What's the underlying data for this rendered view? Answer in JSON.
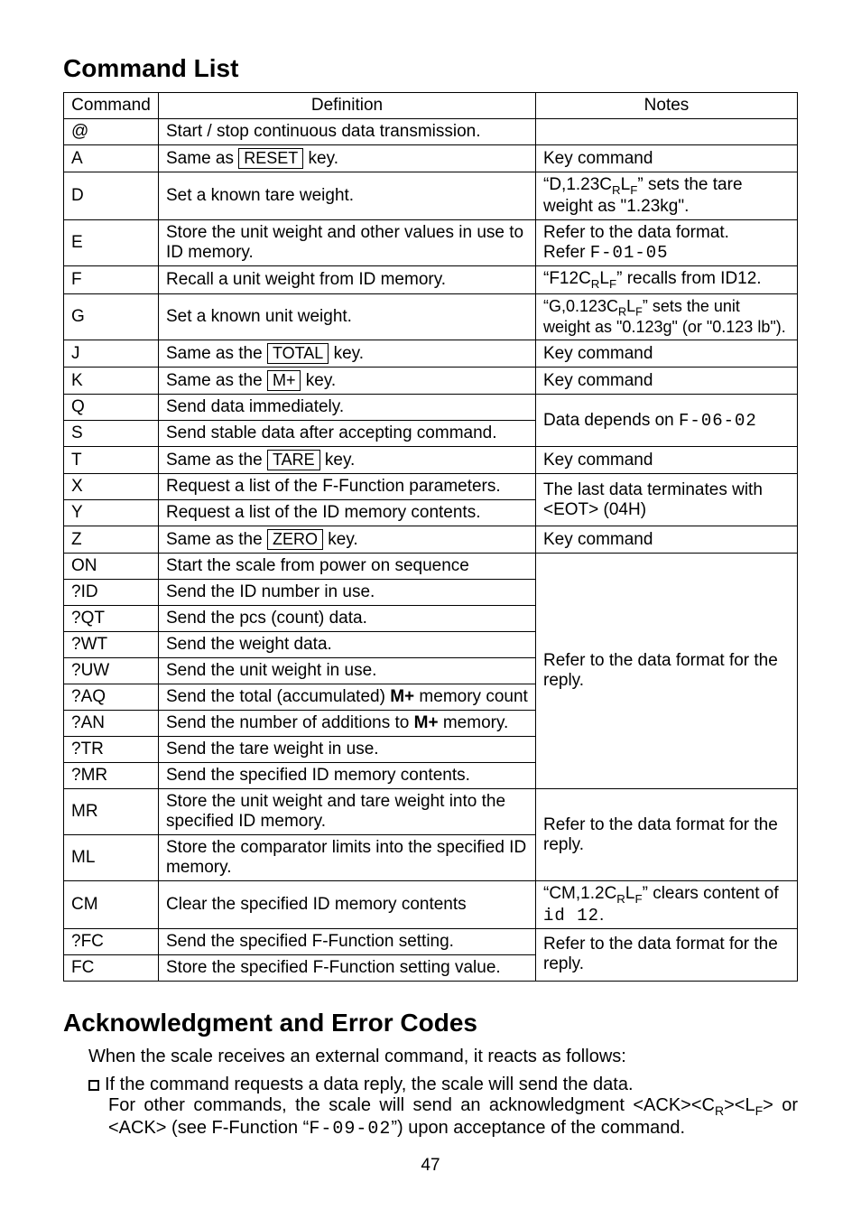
{
  "headings": {
    "command_list": "Command List",
    "ack": "Acknowledgment and Error Codes"
  },
  "table_headers": {
    "command": "Command",
    "definition": "Definition",
    "notes": "Notes"
  },
  "rows": {
    "at": {
      "cmd": "@",
      "def_pre": "Start / stop continuous data transmission.",
      "notes": ""
    },
    "A": {
      "cmd": "A",
      "def_pre": "Same as ",
      "key": "RESET",
      "def_post": " key.",
      "notes": "Key command"
    },
    "D": {
      "cmd": "D",
      "def": "Set a known tare weight.",
      "notes_html": "“D,1.23C<sub>R</sub>L<sub>F</sub>” sets the tare weight as \"1.23kg\"."
    },
    "E": {
      "cmd": "E",
      "def": "Store the unit weight and other values in use to ID memory.",
      "notes_l1": "Refer to the data format.",
      "notes_l2_pre": "Refer ",
      "notes_l2_seg": "F-01-05"
    },
    "F": {
      "cmd": "F",
      "def": "Recall a unit weight from ID memory.",
      "notes_html": "“F12C<sub>R</sub>L<sub>F</sub>” recalls from ID12."
    },
    "G": {
      "cmd": "G",
      "def": "Set a known unit weight.",
      "notes_html": "“G,0.123C<sub>R</sub>L<sub>F</sub>” sets the unit weight as \"0.123g\" (or \"0.123 lb\")."
    },
    "J": {
      "cmd": "J",
      "def_pre": "Same as the ",
      "key": "TOTAL",
      "def_post": " key.",
      "notes": "Key command"
    },
    "K": {
      "cmd": "K",
      "def_pre": "Same as the ",
      "key": "M+",
      "def_post": " key.",
      "notes": "Key command"
    },
    "Q": {
      "cmd": "Q",
      "def": "Send data immediately."
    },
    "S": {
      "cmd": "S",
      "def": "Send stable data after accepting command."
    },
    "QS_notes_pre": "Data depends on ",
    "QS_notes_seg": "F-06-02",
    "T": {
      "cmd": "T",
      "def_pre": "Same as the ",
      "key": "TARE",
      "def_post": " key.",
      "notes": "Key command"
    },
    "X": {
      "cmd": "X",
      "def": "Request a list of the F-Function parameters."
    },
    "Y": {
      "cmd": "Y",
      "def": "Request a list of the ID memory contents."
    },
    "XY_notes": "The last data terminates with <EOT> (04H)",
    "Z": {
      "cmd": "Z",
      "def_pre": "Same as the ",
      "key": "ZERO",
      "def_post": " key.",
      "notes": "Key command"
    },
    "ON": {
      "cmd": "ON",
      "def": "Start the scale from power on sequence"
    },
    "QID": {
      "cmd": "?ID",
      "def": "Send the ID number in use."
    },
    "QQT": {
      "cmd": "?QT",
      "def": "Send the pcs (count) data."
    },
    "QWT": {
      "cmd": "?WT",
      "def": "Send the weight data."
    },
    "QUW": {
      "cmd": "?UW",
      "def": "Send the unit weight in use."
    },
    "QAQ": {
      "cmd": "?AQ",
      "def_pre": "Send the total (accumulated) ",
      "def_bold": "M+",
      "def_post": " memory count"
    },
    "QAN": {
      "cmd": "?AN",
      "def_pre": "Send the number of additions to ",
      "def_bold": "M+",
      "def_post": " memory."
    },
    "QTR": {
      "cmd": "?TR",
      "def": "Send the tare weight in use."
    },
    "QMR": {
      "cmd": "?MR",
      "def": "Send the specified ID memory contents."
    },
    "block_notes": "Refer to the data format for the reply.",
    "MR": {
      "cmd": "MR",
      "def": "Store the unit weight and tare weight into the specified ID memory."
    },
    "ML": {
      "cmd": "ML",
      "def": "Store the comparator limits into the specified ID memory."
    },
    "MRML_notes": "Refer to the data format for the reply.",
    "CM": {
      "cmd": "CM",
      "def": "Clear the specified ID memory contents",
      "notes_html_pre": "“CM,1.2C<sub>R</sub>L<sub>F</sub>” clears content of ",
      "notes_seg": "id 12",
      "notes_post": "."
    },
    "QFC": {
      "cmd": "?FC",
      "def": "Send the specified F-Function setting."
    },
    "FC": {
      "cmd": "FC",
      "def": "Store the specified F-Function setting value."
    },
    "FC_notes": "Refer to the data format for the reply."
  },
  "ack_para": "When the scale receives an external command, it reacts as follows:",
  "bullet": {
    "line1": "If the command requests a data reply, the scale will send the data.",
    "line2_pre": "For other commands, the scale will send an acknowledgment <ACK><C",
    "line2_sub1": "R",
    "line2_mid": "><L",
    "line2_sub2": "F",
    "line2_post": "> or <ACK> (see F-Function “",
    "line2_seg": "F-09-02",
    "line2_end": "”) upon acceptance of the command."
  },
  "page_number": "47"
}
